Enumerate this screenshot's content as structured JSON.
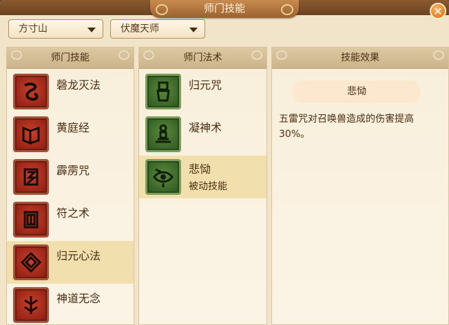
{
  "window": {
    "title": "师门技能",
    "close_label": "✕"
  },
  "filters": {
    "school": "方寸山",
    "title": "伏魔天师"
  },
  "skills_panel": {
    "header": "师门技能",
    "items": [
      {
        "name": "磬龙灭法",
        "icon": "dragon-coil-icon"
      },
      {
        "name": "黄庭经",
        "icon": "scroll-book-icon"
      },
      {
        "name": "霹雳咒",
        "icon": "lightning-rune-icon"
      },
      {
        "name": "符之术",
        "icon": "talisman-icon"
      },
      {
        "name": "归元心法",
        "icon": "spiral-rune-icon",
        "selected": true
      },
      {
        "name": "神道无念",
        "icon": "tree-rune-icon"
      }
    ]
  },
  "spells_panel": {
    "header": "师门法术",
    "items": [
      {
        "name": "归元咒",
        "sub": "",
        "icon": "idol-figure-icon"
      },
      {
        "name": "凝神术",
        "sub": "",
        "icon": "meditation-altar-icon"
      },
      {
        "name": "悲恸",
        "sub": "被动技能",
        "icon": "weeping-eye-icon",
        "selected": true
      }
    ]
  },
  "effect_panel": {
    "header": "技能效果",
    "skill_name": "悲恸",
    "description": "五雷咒对召唤兽造成的伤害提高30%。"
  },
  "colors": {
    "frame": "#6b4322",
    "title_tab": "#b57840",
    "panel_bg": "#f8eedb",
    "panel_header": "#d4bd94",
    "selected_row": "#f1dfae",
    "text": "#4a2c10",
    "skill_icon_red": "#a8301e",
    "spell_icon_green": "#3f6e2e"
  }
}
